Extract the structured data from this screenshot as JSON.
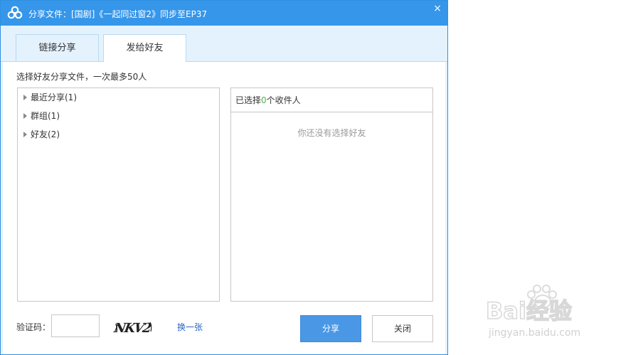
{
  "window": {
    "title": "分享文件：[国剧]《一起同过窗2》同步至EP37",
    "close_glyph": "×",
    "accent_color": "#3596ea"
  },
  "tabs": [
    {
      "label": "链接分享",
      "active": false
    },
    {
      "label": "发给好友",
      "active": true
    }
  ],
  "instruction": "选择好友分享文件，一次最多50人",
  "friend_tree": [
    {
      "label": "最近分享(1)"
    },
    {
      "label": "群组(1)"
    },
    {
      "label": "好友(2)"
    }
  ],
  "selected": {
    "prefix": "已选择",
    "count": "0",
    "suffix": "个收件人",
    "empty_text": "你还没有选择好友",
    "count_color": "#4db24d"
  },
  "captcha": {
    "label": "验证码：",
    "value": "",
    "placeholder": "",
    "image_text": "NKV2",
    "refresh_label": "换一张"
  },
  "buttons": {
    "share_label": "分享",
    "close_label": "关闭"
  },
  "watermark": {
    "brand": "Bai经验",
    "url": "jingyan.baidu.com"
  }
}
